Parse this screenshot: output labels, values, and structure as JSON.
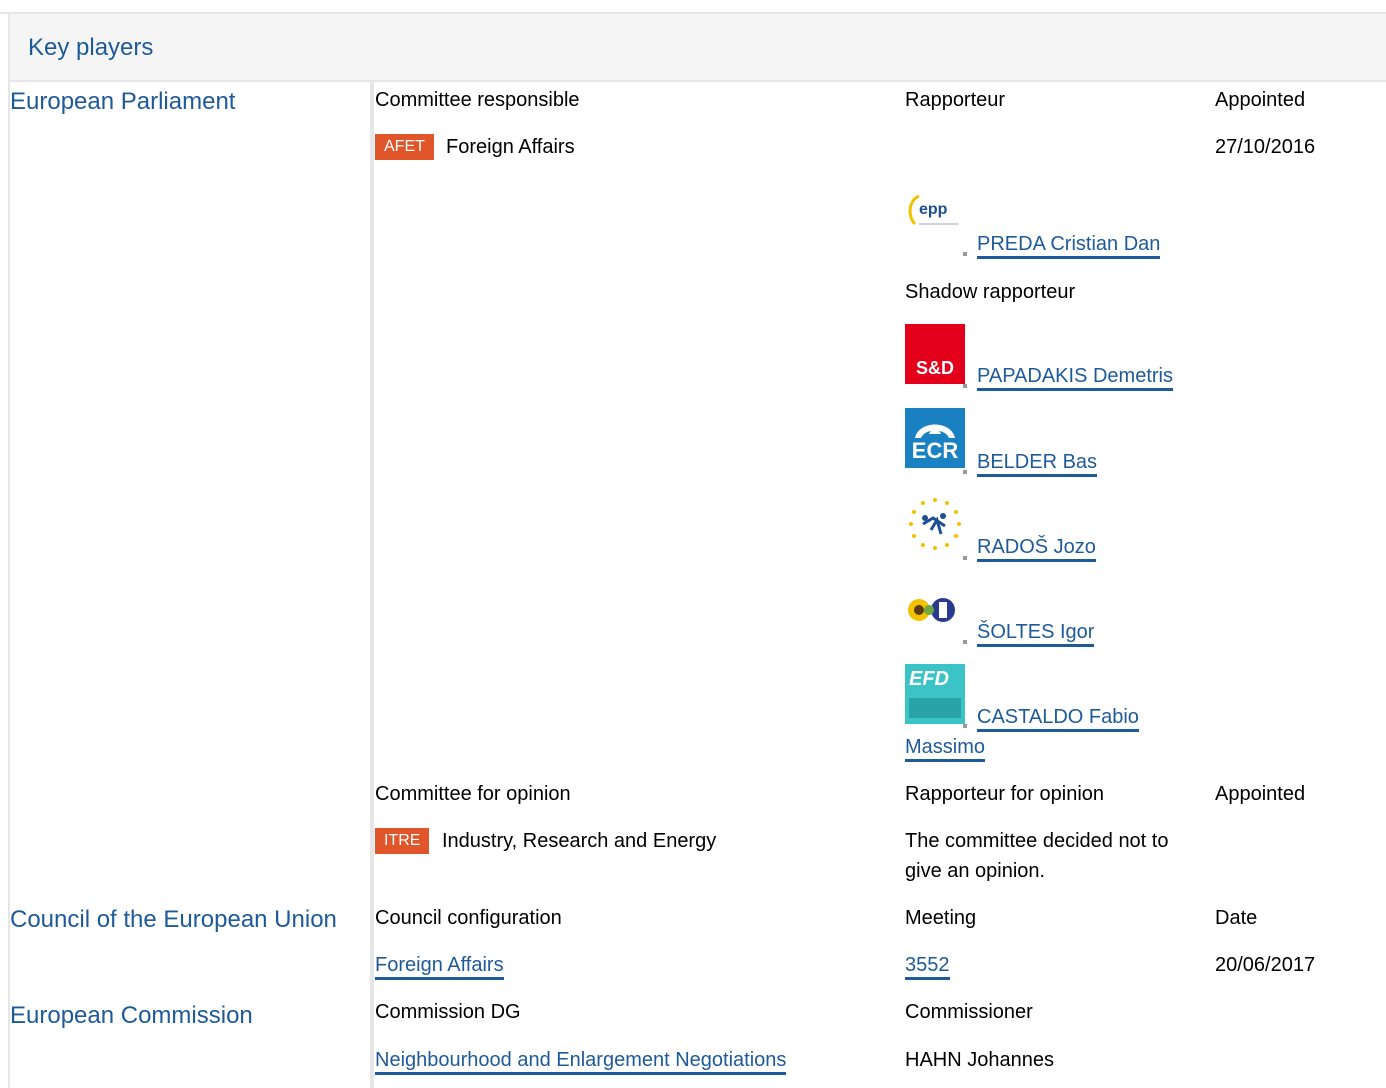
{
  "header": {
    "title": "Key players"
  },
  "institutions": {
    "ep": "European Parliament",
    "council": "Council of the European Union",
    "commission": "European Commission"
  },
  "ep": {
    "responsible": {
      "col1_header": "Committee responsible",
      "col2_header": "Rapporteur",
      "col3_header": "Appointed",
      "committee_code": "AFET",
      "committee_name": "Foreign Affairs",
      "appointed": "27/10/2016",
      "rapporteur": {
        "group_logo": "epp-logo",
        "name": "PREDA Cristian Dan"
      },
      "shadow_label": "Shadow rapporteur",
      "shadows": [
        {
          "group_logo": "s-and-d-logo",
          "logo_text": "S&D",
          "name": "PAPADAKIS Demetris"
        },
        {
          "group_logo": "ecr-logo",
          "logo_text": "ECR",
          "name": "BELDER Bas"
        },
        {
          "group_logo": "alde-logo",
          "name": "RADOŠ Jozo"
        },
        {
          "group_logo": "greens-efa-logo",
          "name": "ŠOLTES Igor"
        },
        {
          "group_logo": "efdd-logo",
          "logo_text": "EFD",
          "name_line1": "CASTALDO Fabio",
          "name_line2": "Massimo"
        }
      ]
    },
    "opinion": {
      "col1_header": "Committee for opinion",
      "col2_header": "Rapporteur for opinion",
      "col3_header": "Appointed",
      "committee_code": "ITRE",
      "committee_name": "Industry, Research and Energy",
      "note_line1": "The committee decided not to",
      "note_line2": "give an opinion."
    }
  },
  "council": {
    "col1_header": "Council configuration",
    "col2_header": "Meeting",
    "col3_header": "Date",
    "configuration": "Foreign Affairs",
    "meeting": "3552",
    "date": "20/06/2017"
  },
  "commission": {
    "col1_header": "Commission DG",
    "col2_header": "Commissioner",
    "dg": "Neighbourhood and Enlargement Negotiations",
    "commissioner": "HAHN Johannes"
  }
}
